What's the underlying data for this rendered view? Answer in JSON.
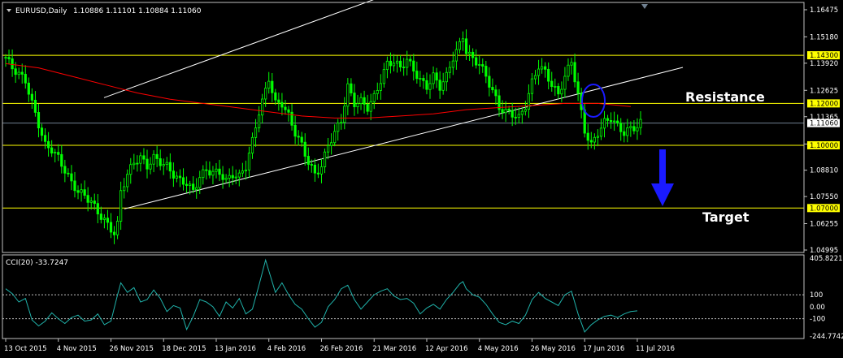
{
  "colors": {
    "background": "#000000",
    "frame": "#c0c0c0",
    "candle": "#00ff00",
    "ma": "#ff0000",
    "level_line": "#ffff00",
    "trend_line": "#ffffff",
    "cci": "#20b2aa",
    "current_price_line": "#708090",
    "annotation_blue": "#1a1aff",
    "label_text": "#ffffff",
    "price_box_bg": "#ffff00",
    "price_box_text": "#000000",
    "current_box_bg": "#ffffff"
  },
  "header": {
    "symbol": "EURUSD,Daily",
    "ohlc": "1.10886 1.11101 1.10884 1.11060",
    "collapse_icon": "triangle-down-icon"
  },
  "chart_data": [
    {
      "type": "candlestick",
      "title": "EURUSD,Daily",
      "ylim": [
        1.04995,
        1.16475
      ],
      "y_ticks": [
        "1.16475",
        "1.15180",
        "1.13920",
        "1.12625",
        "1.11365",
        "1.10060",
        "1.08810",
        "1.07550",
        "1.06255",
        "1.04995"
      ],
      "levels": [
        {
          "label": "1.14300",
          "value": 1.143
        },
        {
          "label": "1.12000",
          "value": 1.12
        },
        {
          "label": "1.10000",
          "value": 1.1
        },
        {
          "label": "1.07000",
          "value": 1.07
        }
      ],
      "current_price": {
        "label": "1.11060",
        "value": 1.1106
      },
      "annotations": [
        {
          "text": "Resistance"
        },
        {
          "text": "Target"
        }
      ],
      "x_ticks": [
        "13 Oct 2015",
        "4 Nov 2015",
        "26 Nov 2015",
        "18 Dec 2015",
        "13 Jan 2016",
        "4 Feb 2016",
        "26 Feb 2016",
        "21 Mar 2016",
        "12 Apr 2016",
        "4 May 2016",
        "26 May 2016",
        "17 Jun 2016",
        "11 Jul 2016"
      ],
      "close_path": [
        [
          0,
          1.142
        ],
        [
          2,
          1.137
        ],
        [
          4,
          1.134
        ],
        [
          6,
          1.131
        ],
        [
          8,
          1.12
        ],
        [
          10,
          1.11
        ],
        [
          12,
          1.1
        ],
        [
          14,
          1.098
        ],
        [
          16,
          1.094
        ],
        [
          18,
          1.088
        ],
        [
          20,
          1.082
        ],
        [
          22,
          1.078
        ],
        [
          24,
          1.076
        ],
        [
          26,
          1.073
        ],
        [
          28,
          1.068
        ],
        [
          30,
          1.064
        ],
        [
          32,
          1.06
        ],
        [
          33,
          1.058
        ],
        [
          34,
          1.062
        ],
        [
          35,
          1.078
        ],
        [
          37,
          1.086
        ],
        [
          39,
          1.092
        ],
        [
          41,
          1.094
        ],
        [
          43,
          1.09
        ],
        [
          45,
          1.094
        ],
        [
          47,
          1.092
        ],
        [
          49,
          1.09
        ],
        [
          51,
          1.086
        ],
        [
          53,
          1.083
        ],
        [
          55,
          1.082
        ],
        [
          57,
          1.078
        ],
        [
          59,
          1.085
        ],
        [
          61,
          1.088
        ],
        [
          63,
          1.087
        ],
        [
          65,
          1.087
        ],
        [
          67,
          1.083
        ],
        [
          69,
          1.086
        ],
        [
          71,
          1.085
        ],
        [
          73,
          1.09
        ],
        [
          75,
          1.102
        ],
        [
          77,
          1.116
        ],
        [
          79,
          1.126
        ],
        [
          80,
          1.132
        ],
        [
          82,
          1.12
        ],
        [
          84,
          1.12
        ],
        [
          86,
          1.114
        ],
        [
          88,
          1.106
        ],
        [
          90,
          1.1
        ],
        [
          92,
          1.092
        ],
        [
          94,
          1.086
        ],
        [
          96,
          1.09
        ],
        [
          98,
          1.1
        ],
        [
          100,
          1.106
        ],
        [
          102,
          1.112
        ],
        [
          104,
          1.128
        ],
        [
          106,
          1.12
        ],
        [
          108,
          1.121
        ],
        [
          110,
          1.118
        ],
        [
          112,
          1.123
        ],
        [
          114,
          1.131
        ],
        [
          116,
          1.139
        ],
        [
          118,
          1.14
        ],
        [
          120,
          1.137
        ],
        [
          122,
          1.141
        ],
        [
          124,
          1.136
        ],
        [
          126,
          1.131
        ],
        [
          128,
          1.128
        ],
        [
          130,
          1.133
        ],
        [
          132,
          1.128
        ],
        [
          134,
          1.133
        ],
        [
          136,
          1.142
        ],
        [
          138,
          1.148
        ],
        [
          139,
          1.152
        ],
        [
          140,
          1.145
        ],
        [
          142,
          1.141
        ],
        [
          144,
          1.139
        ],
        [
          146,
          1.133
        ],
        [
          148,
          1.126
        ],
        [
          150,
          1.118
        ],
        [
          152,
          1.116
        ],
        [
          154,
          1.115
        ],
        [
          156,
          1.113
        ],
        [
          158,
          1.119
        ],
        [
          160,
          1.13
        ],
        [
          162,
          1.138
        ],
        [
          164,
          1.135
        ],
        [
          166,
          1.129
        ],
        [
          168,
          1.124
        ],
        [
          170,
          1.133
        ],
        [
          172,
          1.14
        ],
        [
          174,
          1.124
        ],
        [
          176,
          1.107
        ],
        [
          178,
          1.1
        ],
        [
          180,
          1.106
        ],
        [
          182,
          1.111
        ],
        [
          184,
          1.113
        ],
        [
          186,
          1.109
        ],
        [
          188,
          1.106
        ],
        [
          190,
          1.108
        ],
        [
          192,
          1.109
        ],
        [
          193,
          1.1106
        ]
      ],
      "moving_average": [
        [
          0,
          1.139
        ],
        [
          10,
          1.137
        ],
        [
          20,
          1.133
        ],
        [
          30,
          1.129
        ],
        [
          40,
          1.125
        ],
        [
          50,
          1.122
        ],
        [
          60,
          1.12
        ],
        [
          70,
          1.118
        ],
        [
          80,
          1.116
        ],
        [
          90,
          1.114
        ],
        [
          100,
          1.113
        ],
        [
          110,
          1.113
        ],
        [
          120,
          1.114
        ],
        [
          130,
          1.115
        ],
        [
          140,
          1.117
        ],
        [
          150,
          1.118
        ],
        [
          160,
          1.119
        ],
        [
          170,
          1.12
        ],
        [
          180,
          1.12
        ],
        [
          190,
          1.1185
        ]
      ],
      "trend_lines": [
        {
          "from": [
            0,
            1.0545
          ],
          "to": [
            193,
            1.1333
          ]
        },
        {
          "from": [
            0,
            1.1063
          ],
          "to": [
            193,
            1.2158
          ]
        }
      ]
    },
    {
      "type": "line",
      "title": "CCI(20) -33.7247",
      "ylim": [
        -244.7742,
        405.8221
      ],
      "y_ticks": [
        "405.8221",
        "100",
        "0.00",
        "-100",
        "-244.7742"
      ],
      "levels": [
        100,
        -100
      ],
      "series": [
        {
          "name": "CCI(20)",
          "points": [
            [
              0,
              150
            ],
            [
              2,
              110
            ],
            [
              4,
              40
            ],
            [
              6,
              70
            ],
            [
              8,
              -110
            ],
            [
              10,
              -160
            ],
            [
              12,
              -120
            ],
            [
              14,
              -50
            ],
            [
              16,
              -100
            ],
            [
              18,
              -140
            ],
            [
              20,
              -90
            ],
            [
              22,
              -70
            ],
            [
              24,
              -120
            ],
            [
              26,
              -110
            ],
            [
              28,
              -60
            ],
            [
              30,
              -150
            ],
            [
              32,
              -120
            ],
            [
              34,
              100
            ],
            [
              35,
              200
            ],
            [
              37,
              120
            ],
            [
              39,
              160
            ],
            [
              41,
              40
            ],
            [
              43,
              60
            ],
            [
              45,
              140
            ],
            [
              47,
              70
            ],
            [
              49,
              -40
            ],
            [
              51,
              10
            ],
            [
              53,
              -10
            ],
            [
              55,
              -190
            ],
            [
              57,
              -80
            ],
            [
              59,
              60
            ],
            [
              61,
              40
            ],
            [
              63,
              0
            ],
            [
              65,
              -80
            ],
            [
              67,
              40
            ],
            [
              69,
              -10
            ],
            [
              71,
              70
            ],
            [
              73,
              -60
            ],
            [
              75,
              -20
            ],
            [
              77,
              180
            ],
            [
              79,
              390
            ],
            [
              80,
              300
            ],
            [
              82,
              120
            ],
            [
              84,
              200
            ],
            [
              86,
              100
            ],
            [
              88,
              20
            ],
            [
              90,
              -20
            ],
            [
              92,
              -100
            ],
            [
              94,
              -170
            ],
            [
              96,
              -130
            ],
            [
              98,
              0
            ],
            [
              100,
              60
            ],
            [
              102,
              150
            ],
            [
              104,
              180
            ],
            [
              106,
              60
            ],
            [
              108,
              -20
            ],
            [
              110,
              40
            ],
            [
              112,
              100
            ],
            [
              114,
              130
            ],
            [
              116,
              150
            ],
            [
              118,
              90
            ],
            [
              120,
              60
            ],
            [
              122,
              70
            ],
            [
              124,
              30
            ],
            [
              126,
              -60
            ],
            [
              128,
              -10
            ],
            [
              130,
              20
            ],
            [
              132,
              -20
            ],
            [
              134,
              60
            ],
            [
              136,
              120
            ],
            [
              138,
              190
            ],
            [
              139,
              210
            ],
            [
              140,
              150
            ],
            [
              142,
              100
            ],
            [
              144,
              80
            ],
            [
              146,
              20
            ],
            [
              148,
              -60
            ],
            [
              150,
              -130
            ],
            [
              152,
              -150
            ],
            [
              154,
              -120
            ],
            [
              156,
              -140
            ],
            [
              158,
              -70
            ],
            [
              160,
              60
            ],
            [
              162,
              120
            ],
            [
              164,
              70
            ],
            [
              166,
              40
            ],
            [
              168,
              10
            ],
            [
              170,
              100
            ],
            [
              172,
              130
            ],
            [
              174,
              -60
            ],
            [
              176,
              -210
            ],
            [
              178,
              -150
            ],
            [
              180,
              -110
            ],
            [
              182,
              -80
            ],
            [
              184,
              -70
            ],
            [
              186,
              -90
            ],
            [
              188,
              -60
            ],
            [
              190,
              -40
            ],
            [
              192,
              -34
            ]
          ]
        }
      ]
    }
  ]
}
